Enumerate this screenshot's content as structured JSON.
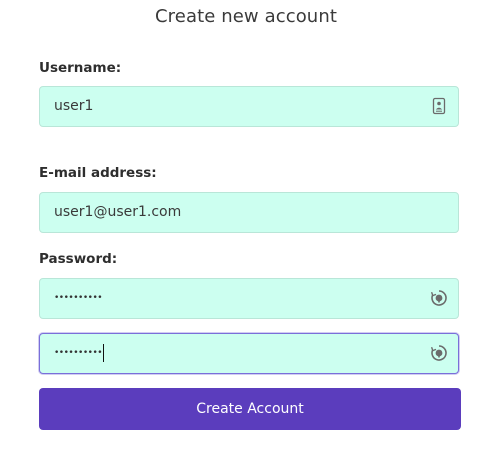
{
  "form": {
    "title": "Create new account",
    "username": {
      "label": "Username:",
      "value": "user1",
      "icon": "contact-card-icon"
    },
    "email": {
      "label": "E-mail address:",
      "value": "user1@user1.com"
    },
    "password": {
      "label": "Password:",
      "masked_value": "••••••••••",
      "icon": "password-manager-icon"
    },
    "password_confirm": {
      "masked_value": "••••••••••",
      "icon": "password-manager-icon",
      "focused": true
    },
    "submit_label": "Create Account"
  },
  "colors": {
    "field_background": "#ccfff0",
    "button_background": "#5b3dbd",
    "focus_border": "#7a6fd9"
  }
}
